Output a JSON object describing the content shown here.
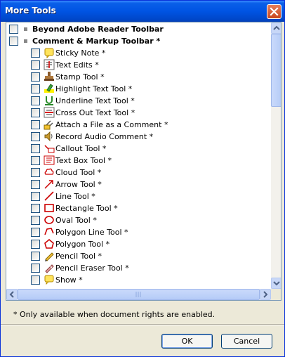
{
  "window": {
    "title": "More Tools"
  },
  "groups": [
    {
      "label": "Beyond Adobe Reader Toolbar"
    },
    {
      "label": "Comment & Markup Toolbar *"
    }
  ],
  "tools": [
    {
      "label": "Sticky Note *",
      "icon": "sticky-note-icon"
    },
    {
      "label": "Text Edits *",
      "icon": "text-edits-icon"
    },
    {
      "label": "Stamp Tool *",
      "icon": "stamp-icon"
    },
    {
      "label": "Highlight Text Tool *",
      "icon": "highlight-icon"
    },
    {
      "label": "Underline Text Tool *",
      "icon": "underline-icon"
    },
    {
      "label": "Cross Out Text Tool *",
      "icon": "cross-out-icon"
    },
    {
      "label": "Attach a File as a Comment *",
      "icon": "attach-file-icon"
    },
    {
      "label": "Record Audio Comment *",
      "icon": "audio-icon"
    },
    {
      "label": "Callout Tool *",
      "icon": "callout-icon"
    },
    {
      "label": "Text Box Tool *",
      "icon": "text-box-icon"
    },
    {
      "label": "Cloud Tool *",
      "icon": "cloud-icon"
    },
    {
      "label": "Arrow Tool *",
      "icon": "arrow-icon"
    },
    {
      "label": "Line Tool *",
      "icon": "line-icon"
    },
    {
      "label": "Rectangle Tool *",
      "icon": "rectangle-icon"
    },
    {
      "label": "Oval Tool *",
      "icon": "oval-icon"
    },
    {
      "label": "Polygon Line Tool *",
      "icon": "polygon-line-icon"
    },
    {
      "label": "Polygon Tool *",
      "icon": "polygon-icon"
    },
    {
      "label": "Pencil Tool *",
      "icon": "pencil-icon"
    },
    {
      "label": "Pencil Eraser Tool *",
      "icon": "pencil-eraser-icon"
    },
    {
      "label": "Show *",
      "icon": "show-icon"
    }
  ],
  "footer": {
    "note": "* Only available when document rights are enabled.",
    "ok_label": "OK",
    "cancel_label": "Cancel"
  }
}
